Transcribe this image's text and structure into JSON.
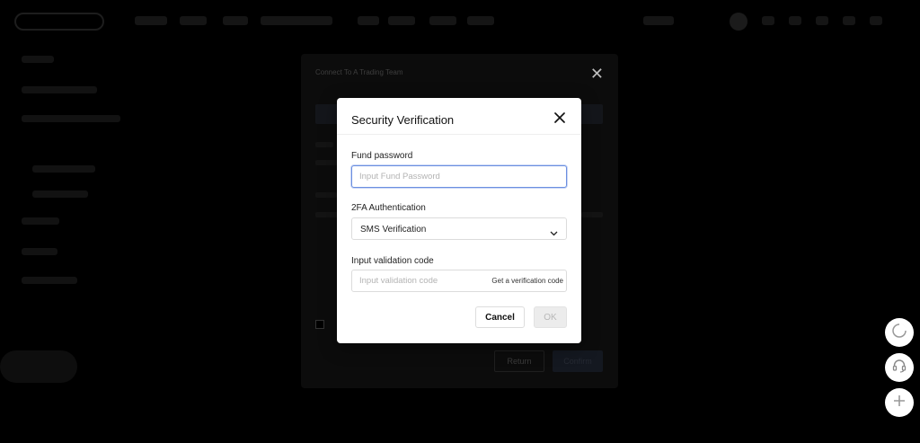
{
  "dialog": {
    "title": "Security Verification",
    "fund_password": {
      "label": "Fund password",
      "placeholder": "Input Fund Password",
      "value": ""
    },
    "twofa": {
      "label": "2FA Authentication",
      "selected": "SMS Verification"
    },
    "validation": {
      "label": "Input validation code",
      "placeholder": "Input validation code",
      "get_code": "Get a verification code"
    },
    "cancel_label": "Cancel",
    "ok_label": "OK"
  },
  "background_modal": {
    "title": "Connect To A Trading Team",
    "return_label": "Return",
    "confirm_label": "Confirm"
  },
  "floating_buttons": [
    "theme-toggle-icon",
    "headset-support-icon",
    "plus-icon"
  ],
  "colors": {
    "overlay": "#000000",
    "dialog_bg": "#ffffff",
    "focus_border": "#6b8fe0",
    "ok_disabled_bg": "#ececec"
  }
}
